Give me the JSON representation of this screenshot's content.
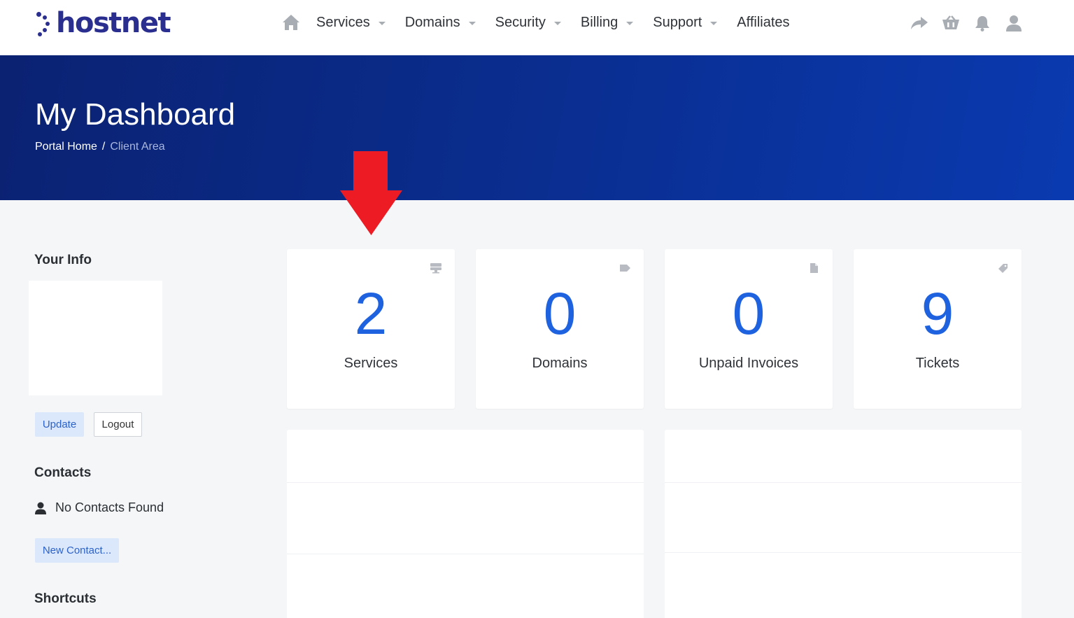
{
  "brand": {
    "name": "hostnet",
    "color": "#2a2f8f"
  },
  "nav": {
    "home_icon": "home-icon",
    "items": [
      {
        "label": "Services",
        "has_dropdown": true
      },
      {
        "label": "Domains",
        "has_dropdown": true
      },
      {
        "label": "Security",
        "has_dropdown": true
      },
      {
        "label": "Billing",
        "has_dropdown": true
      },
      {
        "label": "Support",
        "has_dropdown": true
      },
      {
        "label": "Affiliates",
        "has_dropdown": false
      }
    ],
    "right_icons": [
      "share-icon",
      "cart-icon",
      "bell-icon",
      "user-icon"
    ]
  },
  "hero": {
    "title": "My Dashboard",
    "breadcrumb": {
      "home": "Portal Home",
      "separator": "/",
      "current": "Client Area"
    },
    "gradient_start": "#0b2272",
    "gradient_end": "#0a3ab0"
  },
  "sidebar": {
    "your_info_heading": "Your Info",
    "update_label": "Update",
    "logout_label": "Logout",
    "contacts_heading": "Contacts",
    "no_contacts_text": "No Contacts Found",
    "new_contact_label": "New Contact...",
    "shortcuts_heading": "Shortcuts"
  },
  "stats": [
    {
      "value": "2",
      "label": "Services",
      "icon": "server-icon"
    },
    {
      "value": "0",
      "label": "Domains",
      "icon": "tag-icon"
    },
    {
      "value": "0",
      "label": "Unpaid Invoices",
      "icon": "document-icon"
    },
    {
      "value": "9",
      "label": "Tickets",
      "icon": "ticket-icon"
    }
  ],
  "colors": {
    "accent": "#1f62e0",
    "annotation_arrow": "#ed1c24",
    "button_light": "#dbe7fb"
  }
}
